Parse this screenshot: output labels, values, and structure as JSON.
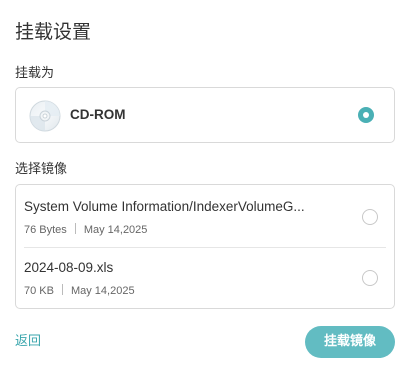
{
  "dialog": {
    "title": "挂载设置"
  },
  "mount_as": {
    "label": "挂载为",
    "option": {
      "name": "CD-ROM",
      "icon": "cd-disc-icon",
      "selected": true
    }
  },
  "select_image": {
    "label": "选择镜像",
    "files": [
      {
        "name": "System Volume Information/IndexerVolumeG...",
        "size": "76 Bytes",
        "date": "May 14,2025",
        "selected": false
      },
      {
        "name": "2024-08-09.xls",
        "size": "70 KB",
        "date": "May 14,2025",
        "selected": false
      }
    ]
  },
  "footer": {
    "back_label": "返回",
    "mount_button_label": "挂载镜像"
  },
  "colors": {
    "accent": "#4ab0b5",
    "button_bg": "#62bcc2",
    "link": "#3aa6ad",
    "border": "#d9d9d9"
  }
}
